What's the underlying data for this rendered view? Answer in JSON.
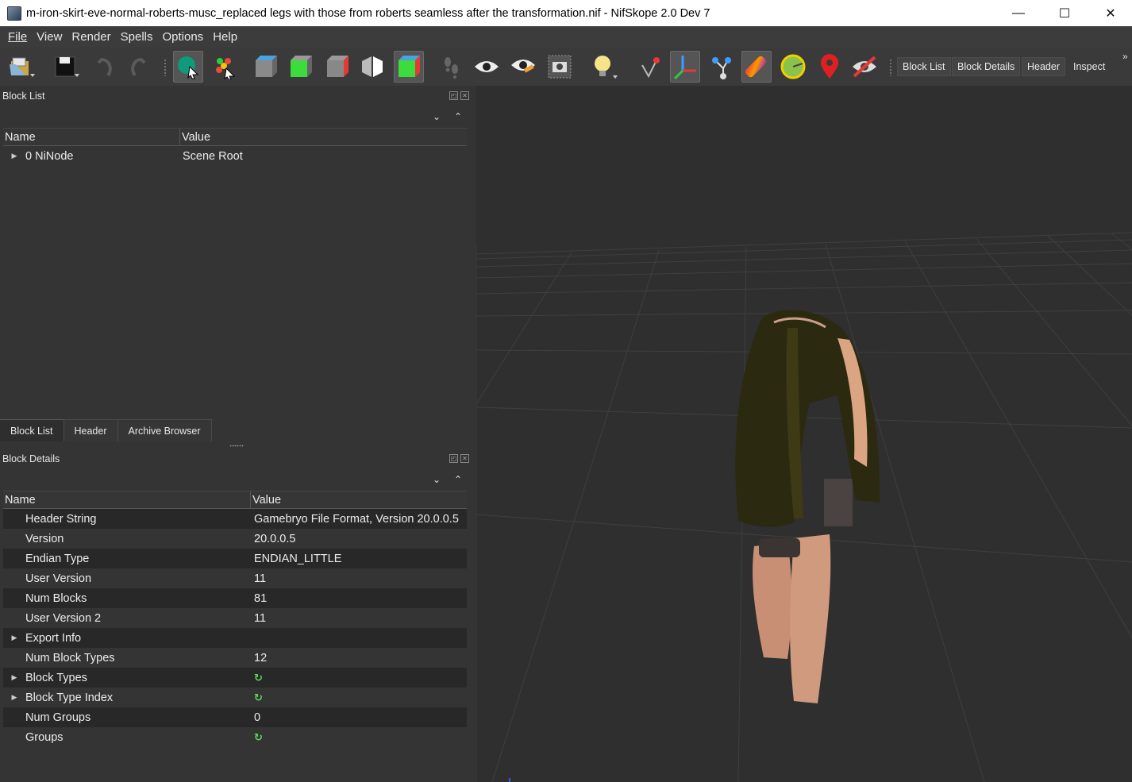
{
  "window": {
    "title": "m-iron-skirt-eve-normal-roberts-musc_replaced legs with those from roberts seamless after the transformation.nif - NifSkope 2.0 Dev 7",
    "minimize": "—",
    "maximize": "☐",
    "close": "✕"
  },
  "menu": [
    "File",
    "View",
    "Render",
    "Spells",
    "Options",
    "Help"
  ],
  "toolbar": {
    "icons": [
      "open-icon",
      "save-icon",
      "undo-icon",
      "redo-icon",
      "select-object-icon",
      "select-vertex-icon",
      "view-top-icon",
      "view-front-icon",
      "view-side-icon",
      "view-flip-icon",
      "view-user-icon",
      "walk-icon",
      "show-hidden-icon",
      "show-markers-icon",
      "screenshot-icon",
      "lighting-icon",
      "show-axes-icon",
      "show-nodes-icon",
      "show-constraints-icon",
      "show-vertex-colors-icon",
      "show-havok-icon",
      "show-markers-pin-icon",
      "hide-markers-icon"
    ],
    "buttons": [
      "Block List",
      "Block Details",
      "Header",
      "Inspect"
    ],
    "overflow": "»"
  },
  "block_list": {
    "title": "Block List",
    "columns": [
      "Name",
      "Value"
    ],
    "rows": [
      {
        "name": "0 NiNode",
        "value": "Scene Root"
      }
    ],
    "tabs": [
      "Block List",
      "Header",
      "Archive Browser"
    ]
  },
  "block_details": {
    "title": "Block Details",
    "columns": [
      "Name",
      "Value"
    ],
    "rows": [
      {
        "name": "Header String",
        "value": "Gamebryo File Format, Version 20.0.0.5",
        "expandable": false
      },
      {
        "name": "Version",
        "value": "20.0.0.5",
        "expandable": false
      },
      {
        "name": "Endian Type",
        "value": "ENDIAN_LITTLE",
        "expandable": false
      },
      {
        "name": "User Version",
        "value": "11",
        "expandable": false
      },
      {
        "name": "Num Blocks",
        "value": "81",
        "expandable": false
      },
      {
        "name": "User Version 2",
        "value": "11",
        "expandable": false
      },
      {
        "name": "Export Info",
        "value": "",
        "expandable": true
      },
      {
        "name": "Num Block Types",
        "value": "12",
        "expandable": false
      },
      {
        "name": "Block Types",
        "value": "",
        "expandable": true,
        "icon": "refresh-icon"
      },
      {
        "name": "Block Type Index",
        "value": "",
        "expandable": true,
        "icon": "refresh-icon"
      },
      {
        "name": "Num Groups",
        "value": "0",
        "expandable": false
      },
      {
        "name": "Groups",
        "value": "",
        "expandable": false,
        "icon": "refresh-icon"
      }
    ]
  },
  "glyphs": {
    "expand": "▶",
    "collapse_down": "⌄",
    "collapse_up": "⌃",
    "refresh": "↻",
    "float": "◰",
    "close_small": "✕"
  }
}
